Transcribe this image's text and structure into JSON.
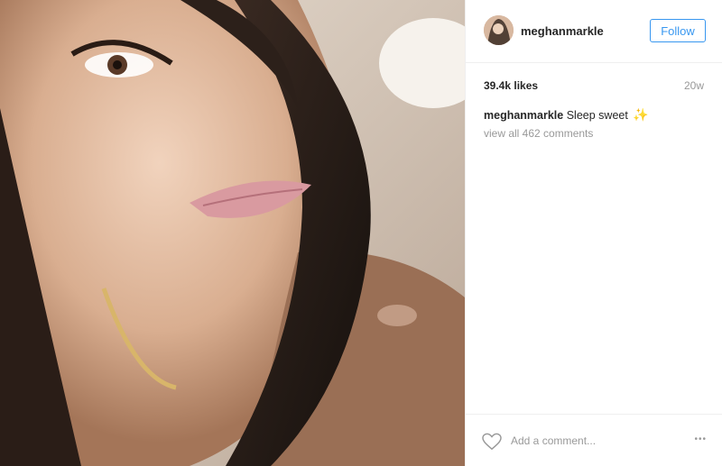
{
  "post": {
    "username": "meghanmarkle",
    "follow_label": "Follow",
    "likes": "39.4k likes",
    "age": "20w",
    "caption_user": "meghanmarkle",
    "caption_text": "Sleep sweet",
    "caption_emoji": "✨",
    "view_comments": "view all 462 comments",
    "comment_placeholder": "Add a comment...",
    "more_icon": "•••"
  },
  "icons": {
    "heart": "heart-icon",
    "more": "more-options-icon"
  },
  "colors": {
    "accent": "#3897f0",
    "text": "#262626",
    "muted": "#999999",
    "divider": "#efefef"
  }
}
